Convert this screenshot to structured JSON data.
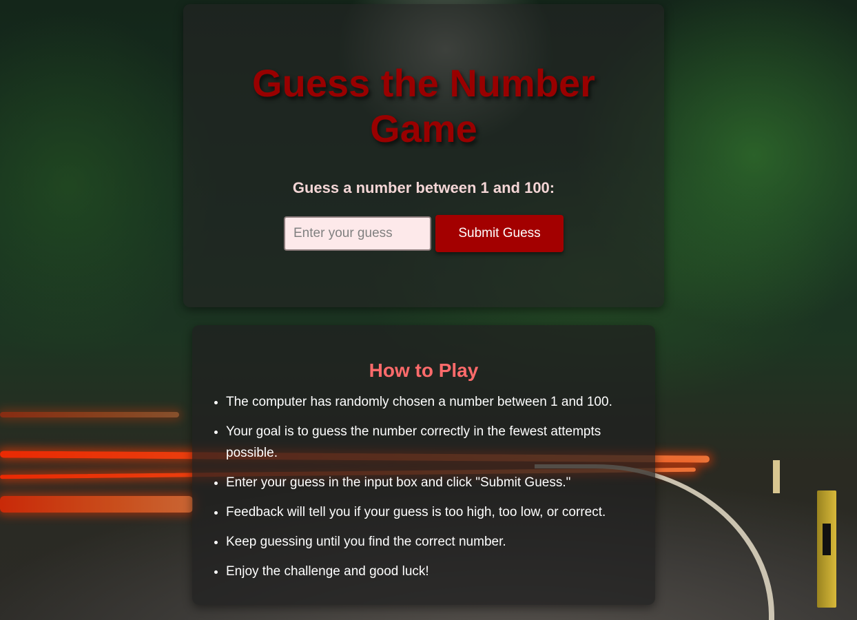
{
  "game": {
    "title": "Guess the Number Game",
    "prompt": "Guess a number between 1 and 100:",
    "input_placeholder": "Enter your guess",
    "submit_label": "Submit Guess"
  },
  "how_to_play": {
    "title": "How to Play",
    "rules": [
      "The computer has randomly chosen a number between 1 and 100.",
      "Your goal is to guess the number correctly in the fewest attempts possible.",
      "Enter your guess in the input box and click \"Submit Guess.\"",
      "Feedback will tell you if your guess is too high, too low, or correct.",
      "Keep guessing until you find the correct number.",
      "Enjoy the challenge and good luck!"
    ]
  },
  "colors": {
    "title_red": "#990000",
    "button_red": "#a30000",
    "howto_title": "#ff6b6b",
    "input_bg": "#fde9ea"
  }
}
